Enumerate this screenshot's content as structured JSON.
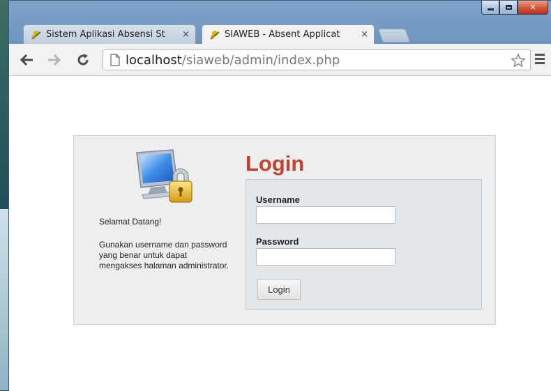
{
  "browser": {
    "tabs": [
      {
        "title": "Sistem Aplikasi Absensi St",
        "close": "×",
        "active": false
      },
      {
        "title": "SIAWEB - Absent Applicat",
        "close": "×",
        "active": true
      }
    ],
    "address": {
      "host": "localhost",
      "path": "/siaweb/admin/index.php"
    },
    "icons": {
      "back": "arrow-left-icon",
      "forward": "arrow-right-icon",
      "reload": "reload-icon",
      "page": "page-icon",
      "bookmark": "star-icon",
      "menu": "menu-icon"
    }
  },
  "login": {
    "title": "Login",
    "welcome": "Selamat Datang!",
    "info": "Gunakan username dan password yang benar untuk dapat mengakses halaman administrator.",
    "username_label": "Username",
    "username_value": "",
    "password_label": "Password",
    "password_value": "",
    "button": "Login"
  },
  "colors": {
    "title": "#c0442d",
    "panel_bg": "#eceef0",
    "form_bg": "#e4e7ea"
  }
}
